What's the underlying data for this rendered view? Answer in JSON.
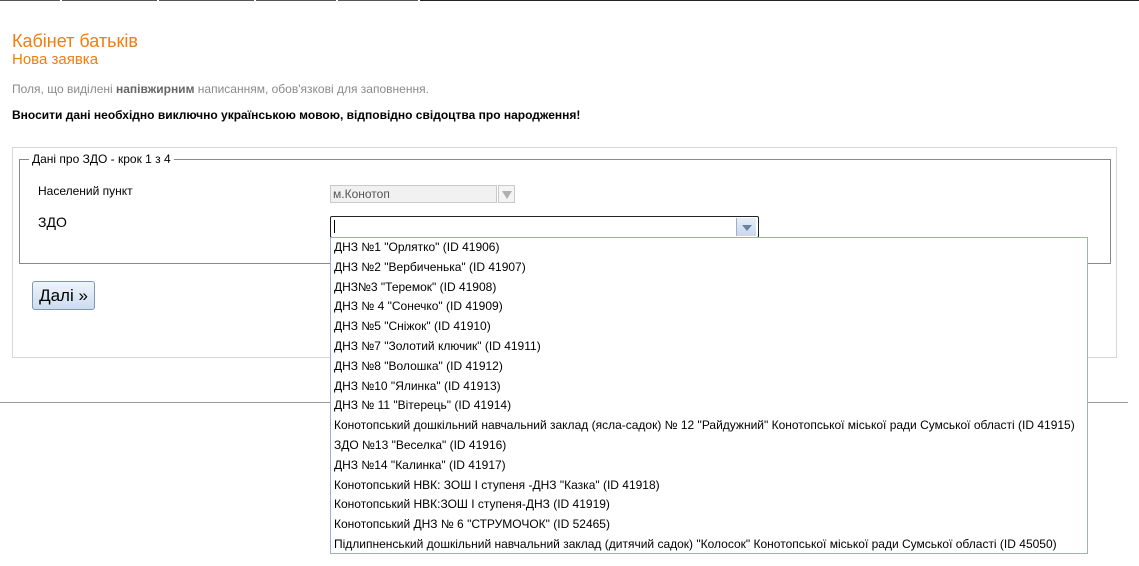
{
  "header": {
    "title": "Кабінет батьків",
    "subtitle": "Нова заявка"
  },
  "notes": {
    "required_prefix": "Поля, що виділені ",
    "required_bold": "напівжирним",
    "required_suffix": " написанням, обов'язкові для заповнення.",
    "warning": "Вносити дані необхідно виключно українською мовою, відповідно свідоцтва про народження!"
  },
  "form": {
    "legend": "Дані про ЗДО - крок 1 з 4",
    "city_label": "Населений пункт",
    "city_value": "м.Конотоп",
    "zdo_label": "ЗДО",
    "zdo_value": "",
    "next_label": "Далі »"
  },
  "dropdown": {
    "options": [
      "ДНЗ №1 \"Орлятко\" (ID 41906)",
      "ДНЗ №2 \"Вербиченька\" (ID 41907)",
      "ДНЗ№3 \"Теремок\" (ID 41908)",
      "ДНЗ № 4 \"Сонечко\" (ID 41909)",
      "ДНЗ №5 \"Сніжок\" (ID 41910)",
      "ДНЗ №7 \"Золотий ключик\" (ID 41911)",
      "ДНЗ №8 \"Волошка\" (ID 41912)",
      "ДНЗ №10 \"Ялинка\" (ID 41913)",
      "ДНЗ № 11 \"Вітерець\" (ID 41914)",
      "Конотопський дошкільний навчальний заклад (ясла-садок) № 12 \"Райдужний\" Конотопської міської ради Сумської області (ID 41915)",
      "ЗДО №13 \"Веселка\" (ID 41916)",
      "ДНЗ №14 \"Калинка\" (ID 41917)",
      "Конотопський НВК: ЗОШ І ступеня -ДНЗ \"Казка\" (ID 41918)",
      "Конотопський НВК:ЗОШ І ступеня-ДНЗ (ID 41919)",
      "Конотопський ДНЗ № 6 \"СТРУМОЧОК\" (ID 52465)",
      "Підлипненський дошкільний навчальний заклад (дитячий садок) \"Колосок\" Конотопської міської ради Сумської області (ID 45050)"
    ]
  }
}
